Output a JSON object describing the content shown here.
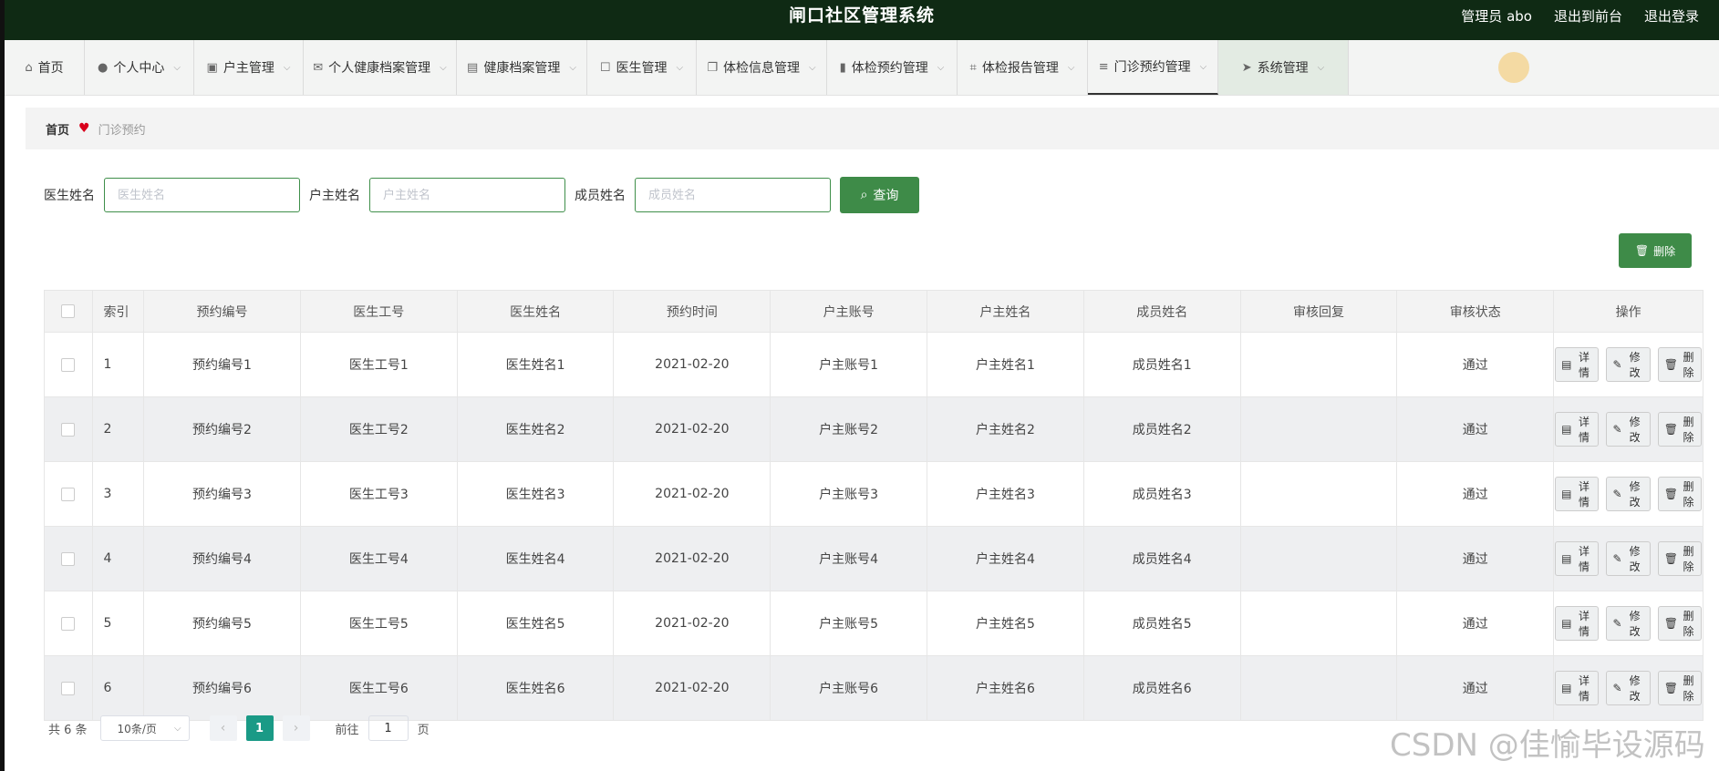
{
  "header": {
    "title": "闸口社区管理系统",
    "user": "管理员 abo",
    "exit_front": "退出到前台",
    "logout": "退出登录"
  },
  "nav": [
    {
      "label": "首页",
      "icon": "home-icon",
      "glyph": "⌂",
      "chevron": false
    },
    {
      "label": "个人中心",
      "icon": "user-icon",
      "glyph": "●",
      "chevron": true
    },
    {
      "label": "户主管理",
      "icon": "chart-icon",
      "glyph": "▣",
      "chevron": true
    },
    {
      "label": "个人健康档案管理",
      "icon": "mail-icon",
      "glyph": "✉",
      "chevron": true
    },
    {
      "label": "健康档案管理",
      "icon": "clipboard-icon",
      "glyph": "▤",
      "chevron": true
    },
    {
      "label": "医生管理",
      "icon": "chat-icon",
      "glyph": "☐",
      "chevron": true
    },
    {
      "label": "体检信息管理",
      "icon": "copy-icon",
      "glyph": "❐",
      "chevron": true
    },
    {
      "label": "体检预约管理",
      "icon": "bar-chart-icon",
      "glyph": "▮",
      "chevron": true
    },
    {
      "label": "体检报告管理",
      "icon": "crop-icon",
      "glyph": "⌗",
      "chevron": true
    },
    {
      "label": "门诊预约管理",
      "icon": "sliders-icon",
      "glyph": "≡",
      "chevron": true
    },
    {
      "label": "系统管理",
      "icon": "send-icon",
      "glyph": "➤",
      "chevron": true
    }
  ],
  "breadcrumb": {
    "home": "首页",
    "current": "门诊预约"
  },
  "search": {
    "doctor_label": "医生姓名",
    "doctor_placeholder": "医生姓名",
    "owner_label": "户主姓名",
    "owner_placeholder": "户主姓名",
    "member_label": "成员姓名",
    "member_placeholder": "成员姓名",
    "query_button": "查询"
  },
  "toolbar": {
    "delete_label": "删除"
  },
  "table": {
    "columns": [
      "索引",
      "预约编号",
      "医生工号",
      "医生姓名",
      "预约时间",
      "户主账号",
      "户主姓名",
      "成员姓名",
      "审核回复",
      "审核状态",
      "操作"
    ],
    "rows": [
      [
        "1",
        "预约编号1",
        "医生工号1",
        "医生姓名1",
        "2021-02-20",
        "户主账号1",
        "户主姓名1",
        "成员姓名1",
        "",
        "通过"
      ],
      [
        "2",
        "预约编号2",
        "医生工号2",
        "医生姓名2",
        "2021-02-20",
        "户主账号2",
        "户主姓名2",
        "成员姓名2",
        "",
        "通过"
      ],
      [
        "3",
        "预约编号3",
        "医生工号3",
        "医生姓名3",
        "2021-02-20",
        "户主账号3",
        "户主姓名3",
        "成员姓名3",
        "",
        "通过"
      ],
      [
        "4",
        "预约编号4",
        "医生工号4",
        "医生姓名4",
        "2021-02-20",
        "户主账号4",
        "户主姓名4",
        "成员姓名4",
        "",
        "通过"
      ],
      [
        "5",
        "预约编号5",
        "医生工号5",
        "医生姓名5",
        "2021-02-20",
        "户主账号5",
        "户主姓名5",
        "成员姓名5",
        "",
        "通过"
      ],
      [
        "6",
        "预约编号6",
        "医生工号6",
        "医生姓名6",
        "2021-02-20",
        "户主账号6",
        "户主姓名6",
        "成员姓名6",
        "",
        "通过"
      ]
    ],
    "actions": {
      "detail": "详情",
      "edit": "修改",
      "delete": "删除"
    }
  },
  "pagination": {
    "total": "共 6 条",
    "page_size": "10条/页",
    "current_page": "1",
    "goto_prefix": "前往",
    "goto_value": "1",
    "goto_suffix": "页"
  },
  "watermark": "CSDN @佳愉毕设源码",
  "colors": {
    "header_bg": "#0f2a14",
    "accent": "#3e8b48",
    "page_active": "#1a9a86"
  }
}
